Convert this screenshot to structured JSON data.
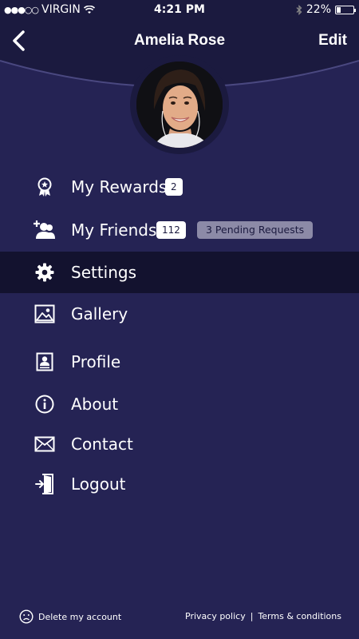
{
  "status_bar": {
    "carrier": "VIRGIN",
    "time": "4:21 PM",
    "battery": "22%",
    "battery_level": 0.22
  },
  "header": {
    "title": "Amelia Rose",
    "edit_label": "Edit"
  },
  "menu": {
    "items": [
      {
        "icon": "rewards-ribbon-icon",
        "label": "My Rewards",
        "badge": "2"
      },
      {
        "icon": "add-friends-icon",
        "label": "My Friends",
        "badge": "112",
        "pending": "3 Pending Requests"
      },
      {
        "icon": "gear-icon",
        "label": "Settings",
        "active": true
      },
      {
        "icon": "image-icon",
        "label": "Gallery"
      },
      {
        "icon": "profile-card-icon",
        "label": "Profile"
      },
      {
        "icon": "info-icon",
        "label": "About"
      },
      {
        "icon": "envelope-icon",
        "label": "Contact"
      },
      {
        "icon": "logout-door-icon",
        "label": "Logout"
      }
    ]
  },
  "footer": {
    "delete_account": "Delete my account",
    "privacy": "Privacy policy",
    "separator": "|",
    "terms": "Terms & conditions"
  },
  "colors": {
    "background": "#252354",
    "header_dark": "#1b1a3f",
    "active_row": "#13122f",
    "pending_badge": "#8c8aa7"
  }
}
